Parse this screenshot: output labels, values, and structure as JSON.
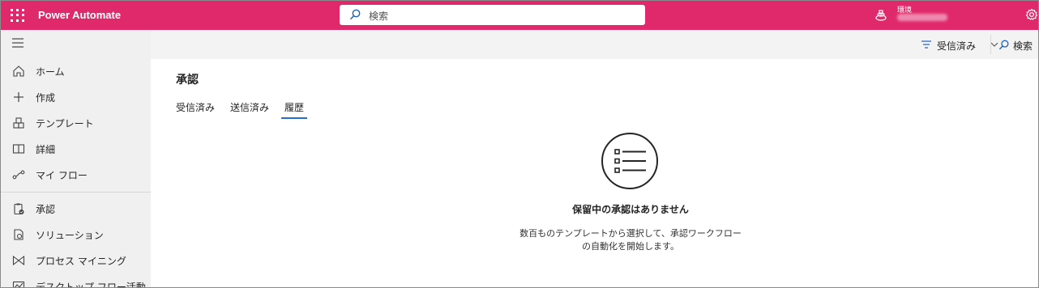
{
  "topbar": {
    "app_name": "Power Automate",
    "search_placeholder": "検索",
    "environment_label": "環境",
    "icons": [
      "app-launcher-icon",
      "search-icon",
      "environment-icon",
      "settings-icon"
    ]
  },
  "nav": {
    "items": [
      {
        "label": "ホーム",
        "icon": "home-icon"
      },
      {
        "label": "作成",
        "icon": "plus-icon"
      },
      {
        "label": "テンプレート",
        "icon": "template-icon"
      },
      {
        "label": "詳細",
        "icon": "book-icon"
      },
      {
        "label": "マイ フロー",
        "icon": "flow-icon"
      },
      {
        "label": "承認",
        "icon": "approval-icon"
      },
      {
        "label": "ソリューション",
        "icon": "solution-icon"
      },
      {
        "label": "プロセス マイニング",
        "icon": "process-mining-icon"
      },
      {
        "label": "デスクトップ フロー活動",
        "icon": "desktop-flow-icon"
      }
    ]
  },
  "commandbar": {
    "filter_label": "受信済み",
    "search_label": "検索"
  },
  "main": {
    "title": "承認",
    "tabs": [
      {
        "label": "受信済み",
        "active": false
      },
      {
        "label": "送信済み",
        "active": false
      },
      {
        "label": "履歴",
        "active": true
      }
    ],
    "empty_state": {
      "icon": "list-icon",
      "title": "保留中の承認はありません",
      "description_line1": "数百ものテンプレートから選択して、承認ワークフロー",
      "description_line2": "の自動化を開始します。"
    }
  },
  "colors": {
    "brand": "#e0296a",
    "nav_bg": "#f0f0f0",
    "accent": "#2a6ad6"
  }
}
